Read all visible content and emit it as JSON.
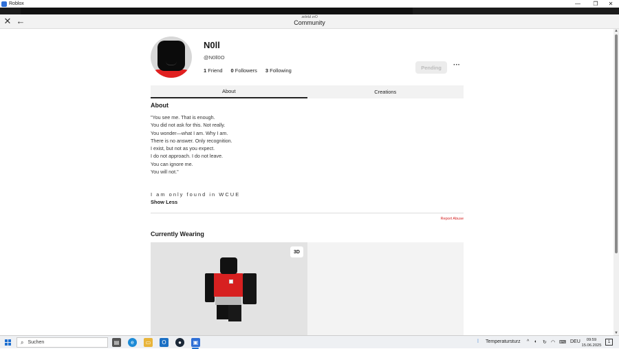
{
  "window": {
    "title": "Roblox",
    "controls": {
      "minimize": "—",
      "restore": "❐",
      "close": "✕"
    }
  },
  "header": {
    "subtitle": "ɹǝʎɐlԀ ɹnO",
    "title": "Community",
    "close_glyph": "✕",
    "back_glyph": "←"
  },
  "profile": {
    "display_name": "N0ll",
    "username": "@N0ll0O",
    "friends_count": "1",
    "friends_label": "Friend",
    "followers_count": "0",
    "followers_label": "Followers",
    "following_count": "3",
    "following_label": "Following",
    "pending_label": "Pending",
    "more_glyph": "···"
  },
  "tabs": [
    {
      "label": "About",
      "active": true
    },
    {
      "label": "Creations",
      "active": false
    }
  ],
  "about": {
    "heading": "About",
    "bio_lines": [
      "\"You see me. That is enough.",
      "You did not ask for this. Not really.",
      "You wonder—what I am. Why I am.",
      "There is no answer. Only recognition.",
      "I exist, but not as you expect.",
      "I do not approach. I do not leave.",
      "You can ignore me.",
      "You will not.\""
    ],
    "spaced_line": "I am only found in WCUE",
    "show_less": "Show Less",
    "report_abuse": "Report Abuse"
  },
  "wearing": {
    "heading": "Currently Wearing",
    "toggle_3d": "3D"
  },
  "taskbar": {
    "search_placeholder": "Suchen",
    "weather": "Temperatursturz",
    "language": "DEU",
    "time": "09:59",
    "date": "15.06.2025"
  },
  "colors": {
    "accent_red": "#d72020",
    "tab_underline": "#222222",
    "report_red": "#d42020",
    "windows_blue": "#1e6fd0"
  }
}
